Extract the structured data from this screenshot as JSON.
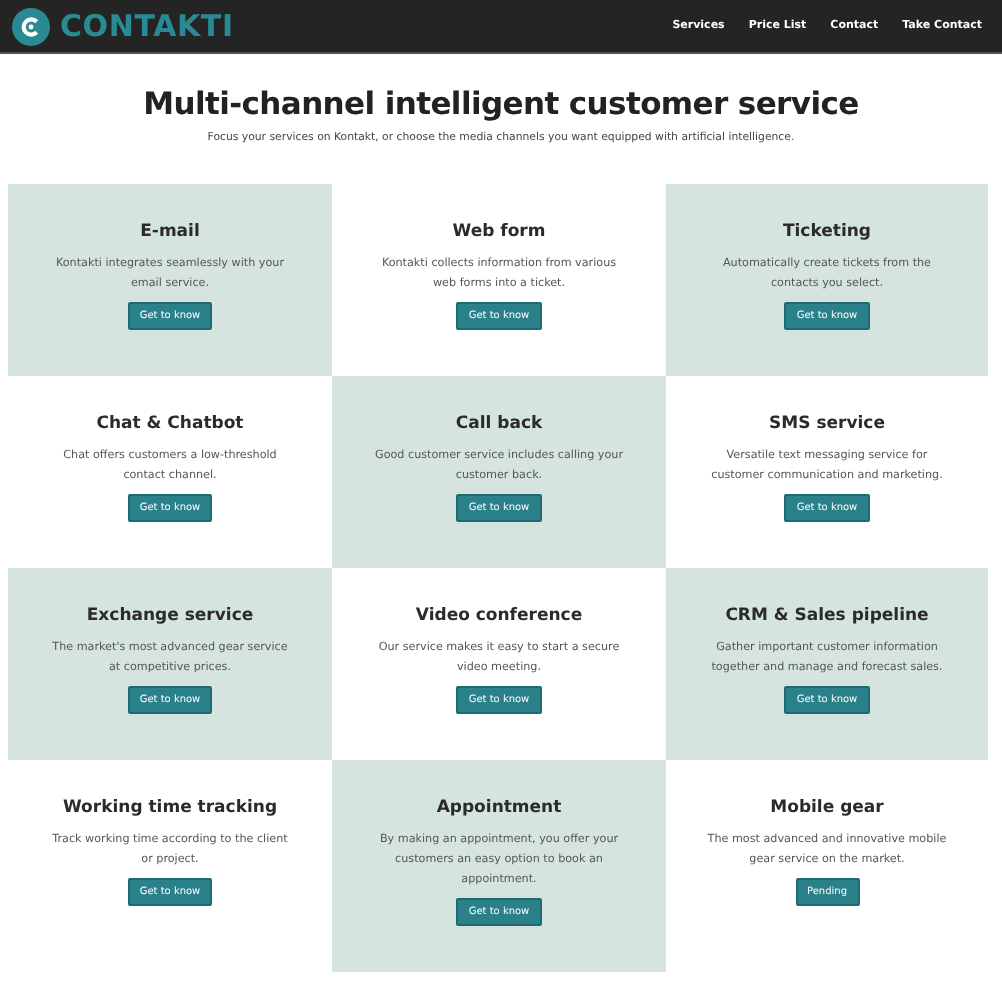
{
  "header": {
    "logo_text": "CONTAKTI",
    "nav": [
      "Services",
      "Price List",
      "Contact",
      "Take Contact"
    ]
  },
  "heading": "Multi-channel intelligent customer service",
  "intro": "Focus your services on Kontakt, or choose the media channels you want equipped with artificial intelligence.",
  "services": [
    {
      "title": "E-mail",
      "text": "Kontakti integrates seamlessly with your email service.",
      "button": "Get to know",
      "tinted": true
    },
    {
      "title": "Web form",
      "text": "Kontakti collects information from various web forms into a ticket.",
      "button": "Get to know",
      "tinted": false
    },
    {
      "title": "Ticketing",
      "text": "Automatically create tickets from the contacts you select.",
      "button": "Get to know",
      "tinted": true
    },
    {
      "title": "Chat & Chatbot",
      "text": "Chat offers customers a low-threshold contact channel.",
      "button": "Get to know",
      "tinted": false
    },
    {
      "title": "Call back",
      "text": "Good customer service includes calling your customer back.",
      "button": "Get to know",
      "tinted": true
    },
    {
      "title": "SMS service",
      "text": "Versatile text messaging service for customer communication and marketing.",
      "button": "Get to know",
      "tinted": false
    },
    {
      "title": "Exchange service",
      "text": "The market's most advanced gear service at competitive prices.",
      "button": "Get to know",
      "tinted": true
    },
    {
      "title": "Video conference",
      "text": "Our service makes it easy to start a secure video meeting.",
      "button": "Get to know",
      "tinted": false
    },
    {
      "title": "CRM & Sales pipeline",
      "text": "Gather important customer information together and manage and forecast sales.",
      "button": "Get to know",
      "tinted": true
    },
    {
      "title": "Working time tracking",
      "text": "Track working time according to the client or project.",
      "button": "Get to know",
      "tinted": false
    },
    {
      "title": "Appointment",
      "text": "By making an appointment, you offer your customers an easy option to book an appointment.",
      "button": "Get to know",
      "tinted": true
    },
    {
      "title": "Mobile gear",
      "text": "The most advanced and innovative mobile gear service on the market.",
      "button": "Pending",
      "tinted": false
    }
  ]
}
